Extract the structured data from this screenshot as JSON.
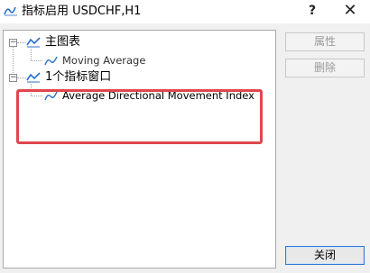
{
  "window": {
    "title": "指标启用 USDCHF,H1",
    "help_label": "?",
    "close_label": "✕"
  },
  "tree": {
    "main_chart": {
      "label": "主图表",
      "expander": "−",
      "children": [
        {
          "label": "Moving Average"
        }
      ]
    },
    "indicator_window": {
      "label": "1个指标窗口",
      "expander": "−",
      "children": [
        {
          "label": "Average Directional Movement Index"
        }
      ]
    }
  },
  "buttons": {
    "properties": "属性",
    "delete": "删除",
    "close": "关闭"
  },
  "colors": {
    "highlight_border": "#e0464d",
    "icon_blue": "#2b6fc8",
    "focus_border": "#2f7ad6"
  },
  "icons": {
    "app": "indicator-wave-icon",
    "folder": "chart-window-icon",
    "indicator": "indicator-line-icon"
  }
}
